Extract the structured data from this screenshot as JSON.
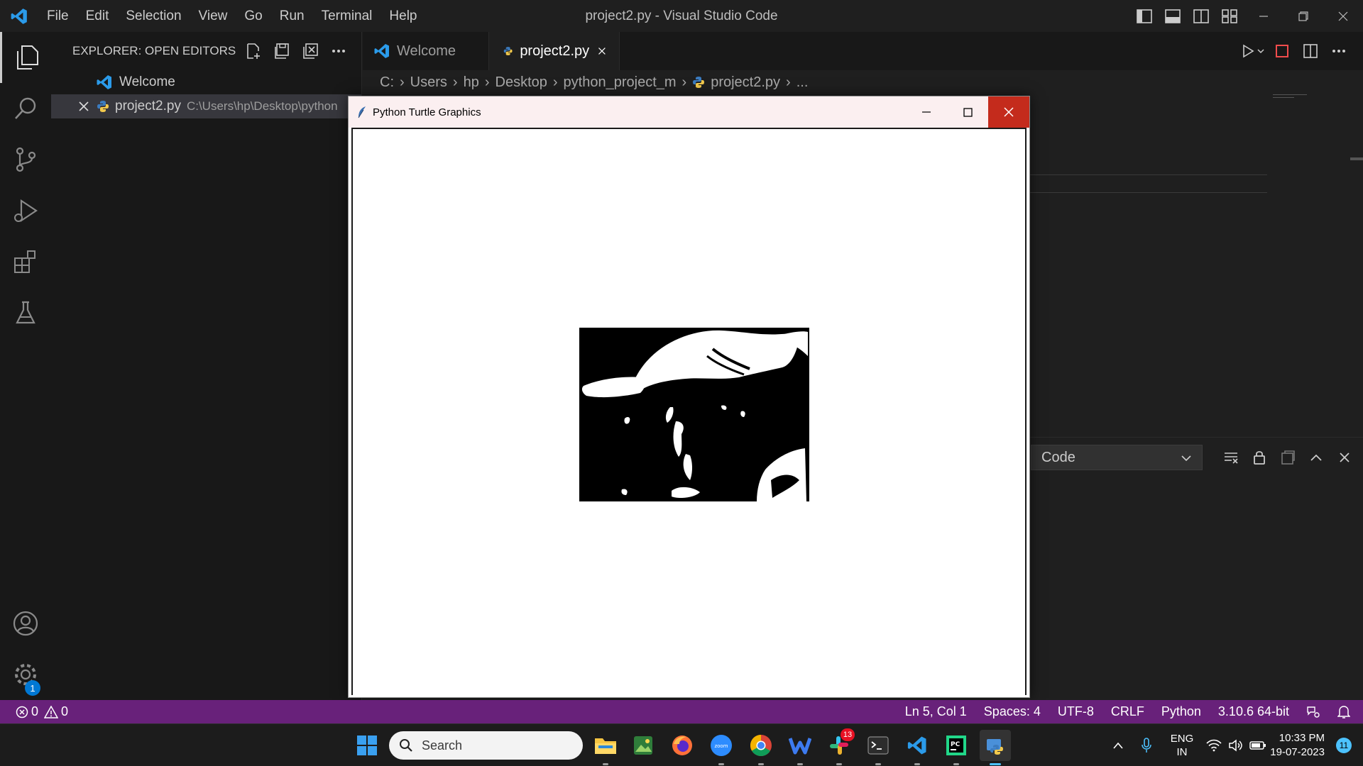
{
  "window": {
    "title": "project2.py - Visual Studio Code",
    "menu": [
      "File",
      "Edit",
      "Selection",
      "View",
      "Go",
      "Run",
      "Terminal",
      "Help"
    ]
  },
  "sidebar": {
    "header": "EXPLORER: OPEN EDITORS",
    "open_editors": [
      {
        "name": "Welcome",
        "path": ""
      },
      {
        "name": "project2.py",
        "path": "C:\\Users\\hp\\Desktop\\python"
      }
    ]
  },
  "tabs": [
    {
      "label": "Welcome",
      "active": false
    },
    {
      "label": "project2.py",
      "active": true
    }
  ],
  "breadcrumb": [
    "C:",
    "Users",
    "hp",
    "Desktop",
    "python_project_m",
    "project2.py",
    "..."
  ],
  "panel": {
    "select_value": "Code"
  },
  "turtle_window": {
    "title": "Python Turtle Graphics"
  },
  "activity_bar": {
    "settings_badge": "1"
  },
  "statusbar": {
    "errors": "0",
    "warnings": "0",
    "position": "Ln 5, Col 1",
    "spaces": "Spaces: 4",
    "encoding": "UTF-8",
    "eol": "CRLF",
    "language": "Python",
    "interpreter": "3.10.6 64-bit"
  },
  "taskbar": {
    "search_placeholder": "Search",
    "slack_badge": "13",
    "lang_line1": "ENG",
    "lang_line2": "IN",
    "time": "10:33 PM",
    "date": "19-07-2023",
    "notification_count": "11"
  },
  "colors": {
    "statusbar": "#68217a",
    "accent": "#0078d4",
    "close": "#c42b1c"
  }
}
